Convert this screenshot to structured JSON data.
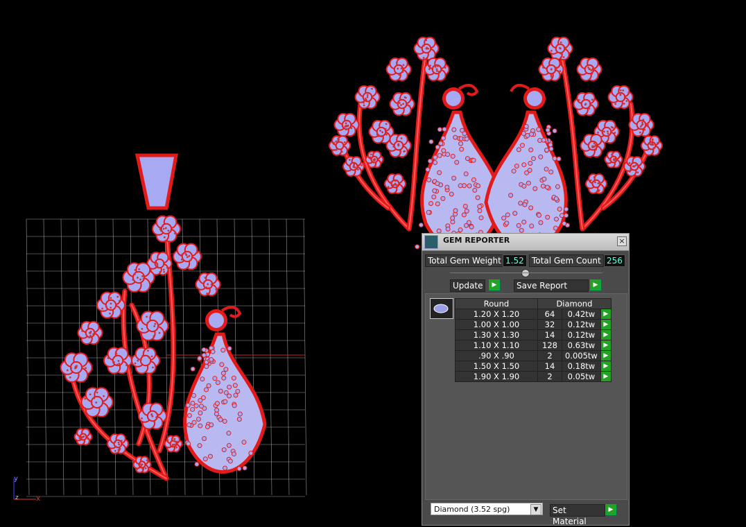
{
  "window": {
    "title": "GEM REPORTER",
    "close_glyph": "×"
  },
  "stats": {
    "total_weight_label": "Total Gem Weight",
    "total_weight": "1.52",
    "total_count_label": "Total Gem Count",
    "total_count": "256"
  },
  "actions": {
    "update_label": "Update",
    "save_label": "Save Report",
    "go_glyph": "▶"
  },
  "table": {
    "headers": [
      "Round",
      "Diamond"
    ],
    "rows": [
      [
        "1.20 X 1.20",
        "64",
        "0.42tw"
      ],
      [
        "1.00 X 1.00",
        "32",
        "0.12tw"
      ],
      [
        "1.30 X 1.30",
        "14",
        "0.12tw"
      ],
      [
        "1.10 X 1.10",
        "128",
        "0.63tw"
      ],
      [
        ".90 X .90",
        "2",
        "0.005tw"
      ],
      [
        "1.50 X 1.50",
        "14",
        "0.18tw"
      ],
      [
        "1.90 X 1.90",
        "2",
        "0.05tw"
      ]
    ]
  },
  "material": {
    "selected": "Diamond     (3.52 spg)",
    "set_label": "Set Material",
    "arrow": "▼"
  },
  "axes": {
    "y": "y",
    "x": "x",
    "z": "z"
  },
  "colors": {
    "metal": "#e31a1a",
    "gem": "#a7a9f3",
    "grid": "#cfcfcf"
  }
}
